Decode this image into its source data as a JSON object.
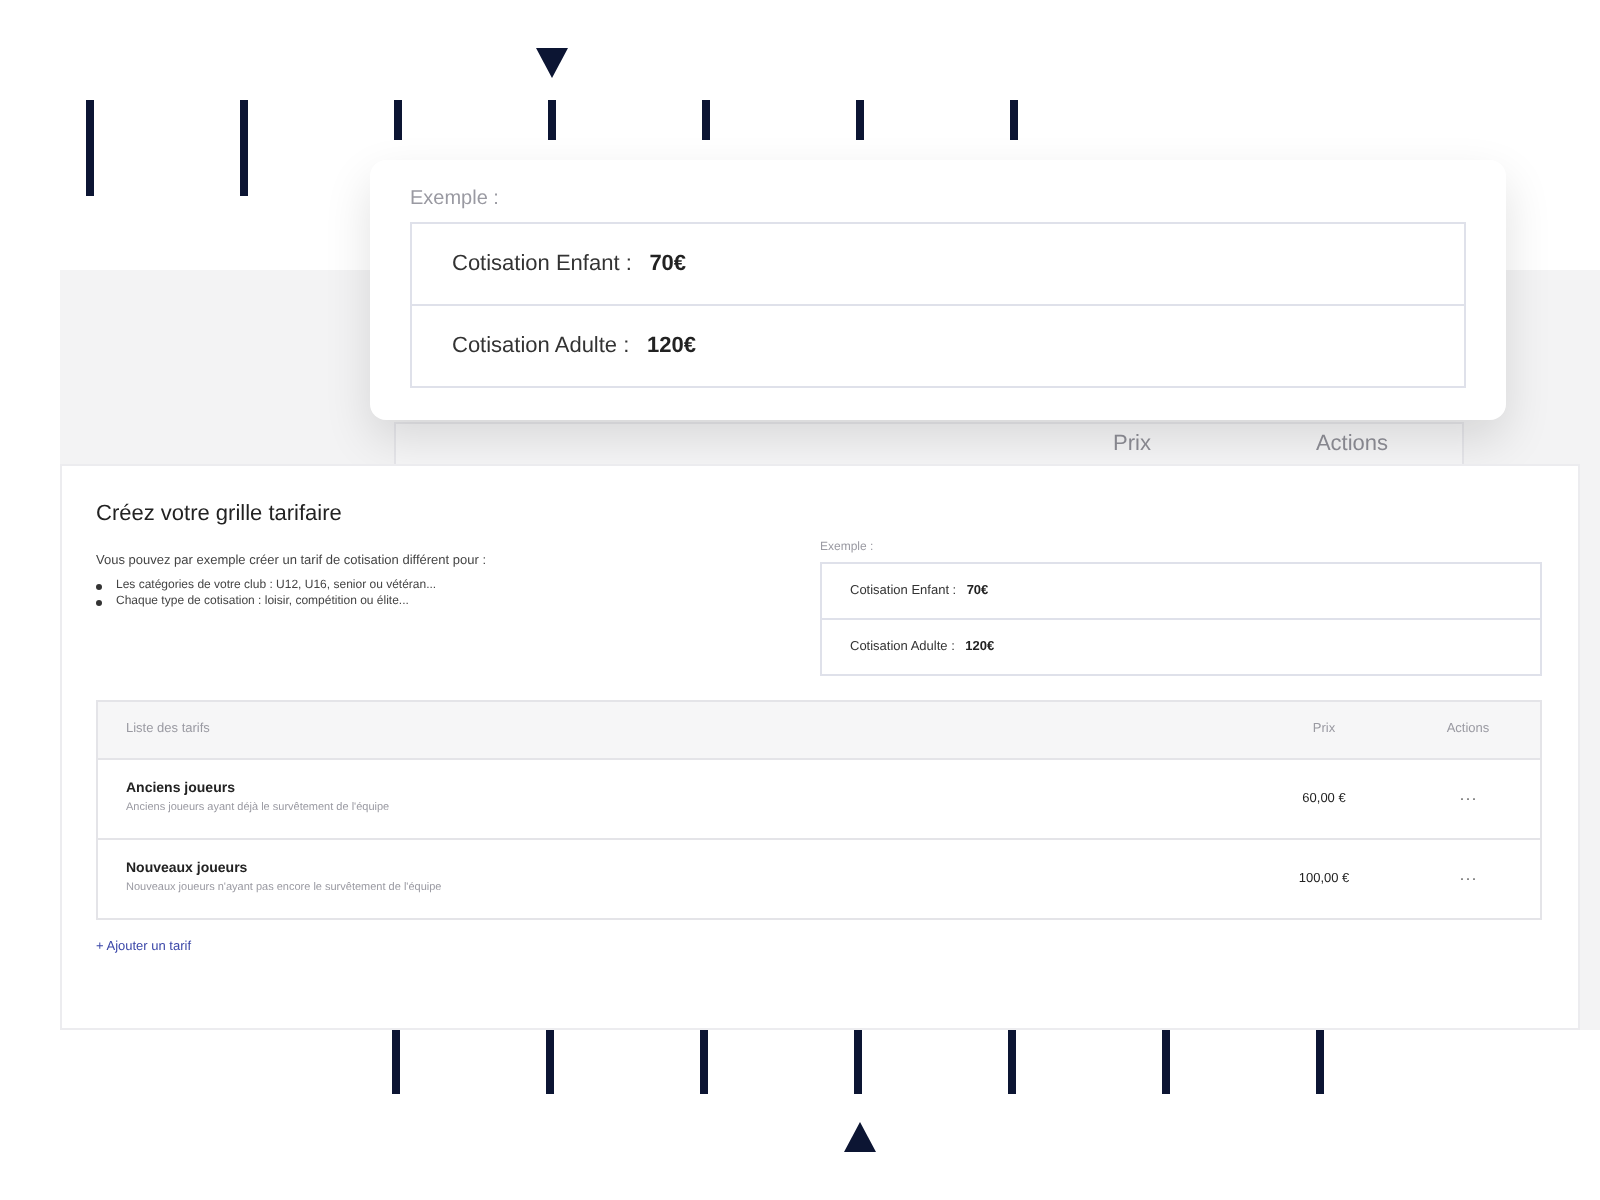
{
  "callout": {
    "label": "Exemple :",
    "rows": [
      {
        "label": "Cotisation Enfant :",
        "value": "70€"
      },
      {
        "label": "Cotisation Adulte :",
        "value": "120€"
      }
    ]
  },
  "backdrop_header": {
    "columns": [
      "Prix",
      "Actions"
    ]
  },
  "card": {
    "title": "Créez votre grille tarifaire",
    "intro": "Vous pouvez par exemple créer un tarif de cotisation différent pour :",
    "bullets": [
      "Les catégories de votre club : U12, U16, senior ou vétéran...",
      "Chaque type de cotisation : loisir, compétition ou élite..."
    ],
    "example": {
      "label": "Exemple :",
      "rows": [
        {
          "label": "Cotisation Enfant :",
          "value": "70€"
        },
        {
          "label": "Cotisation Adulte :",
          "value": "120€"
        }
      ]
    },
    "table": {
      "columns": [
        "Liste des tarifs",
        "Prix",
        "Actions"
      ],
      "rows": [
        {
          "name": "Anciens joueurs",
          "description": "Anciens joueurs ayant déjà le survêtement de l'équipe",
          "price": "60,00 €",
          "actions": "···"
        },
        {
          "name": "Nouveaux joueurs",
          "description": "Nouveaux joueurs n'ayant pas encore le survêtement de l'équipe",
          "price": "100,00 €",
          "actions": "···"
        }
      ]
    },
    "add_link": "+ Ajouter un tarif"
  }
}
